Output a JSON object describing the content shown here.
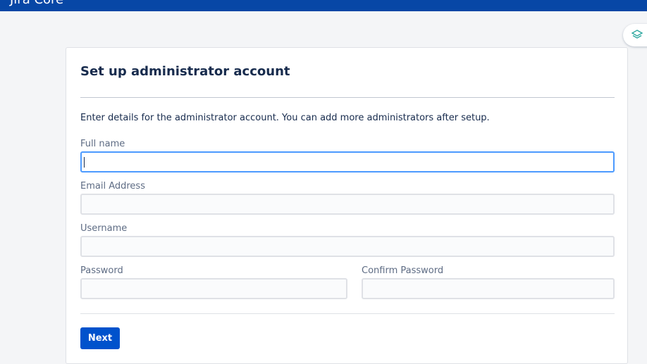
{
  "header": {
    "brand": "Jira Core"
  },
  "floating_widget": {
    "icon": "layers-icon"
  },
  "form": {
    "title": "Set up administrator account",
    "intro": "Enter details for the administrator account. You can add more administrators after setup.",
    "full_name": {
      "label": "Full name",
      "value": ""
    },
    "email": {
      "label": "Email Address",
      "value": ""
    },
    "username": {
      "label": "Username",
      "value": ""
    },
    "password": {
      "label": "Password",
      "value": ""
    },
    "confirm_password": {
      "label": "Confirm Password",
      "value": ""
    },
    "next_label": "Next"
  },
  "colors": {
    "header_bg": "#0747a6",
    "primary_button": "#0052cc",
    "focus_border": "#4c9aff"
  }
}
